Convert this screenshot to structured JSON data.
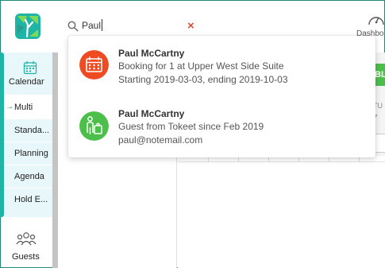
{
  "header": {
    "search_value": "Paul",
    "clear_icon": "close-icon",
    "dashboard_label": "Dashbo"
  },
  "sidebar": {
    "calendar_label": "Calendar",
    "items": [
      {
        "label": "Multi",
        "active": true
      },
      {
        "label": "Standa..."
      },
      {
        "label": "Planning"
      },
      {
        "label": "Agenda"
      },
      {
        "label": "Hold E..."
      }
    ],
    "guests_label": "Guests"
  },
  "background": {
    "green_button_label": "BL",
    "day_label": "TU",
    "day_number": "7"
  },
  "results": [
    {
      "icon": "booking-calendar-icon",
      "icon_color": "#ef4b23",
      "name": "Paul McCartny",
      "line1": "Booking for 1 at Upper West Side Suite",
      "line2": "Starting 2019-03-03, ending 2019-10-03"
    },
    {
      "icon": "guest-luggage-icon",
      "icon_color": "#4cbf4a",
      "name": "Paul McCartny",
      "line1": "Guest from Tokeet since Feb 2019",
      "line2": "paul@notemail.com"
    }
  ],
  "colors": {
    "accent_teal": "#1eb5a6",
    "sidebar_bg": "#e8f7fa",
    "clear_red": "#e04a2f",
    "green": "#4cbf4a"
  }
}
